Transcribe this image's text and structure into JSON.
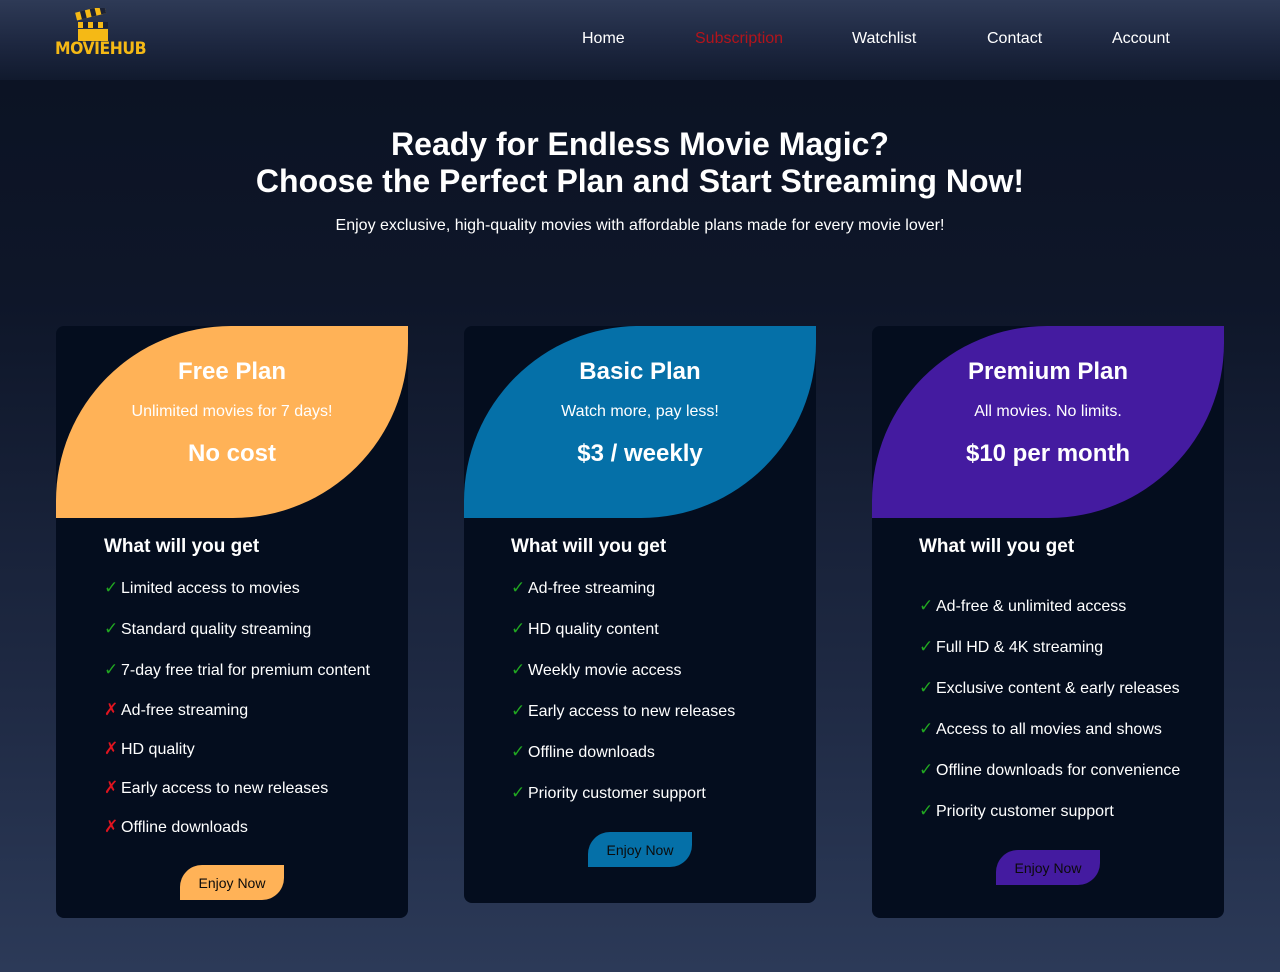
{
  "brand": {
    "name": "MOVIEHUB",
    "logo_icon": "clapperboard-icon",
    "color": "#f5b915"
  },
  "nav": [
    {
      "label": "Home",
      "active": false
    },
    {
      "label": "Subscription",
      "active": true
    },
    {
      "label": "Watchlist",
      "active": false
    },
    {
      "label": "Contact",
      "active": false
    },
    {
      "label": "Account",
      "active": false
    }
  ],
  "hero": {
    "title_line1": "Ready for Endless Movie Magic?",
    "title_line2": "Choose the Perfect Plan and Start Streaming Now!",
    "subtitle": "Enjoy exclusive, high-quality movies with affordable plans made for every movie lover!"
  },
  "plans": [
    {
      "name": "Free Plan",
      "tagline": "Unlimited movies for 7 days!",
      "price": "No cost",
      "accent": "#ffb257",
      "features_title": "What will you get",
      "features": [
        {
          "text": "Limited access to movies",
          "included": true
        },
        {
          "text": "Standard quality streaming",
          "included": true
        },
        {
          "text": "7-day free trial for premium content",
          "included": true
        },
        {
          "text": "Ad-free streaming",
          "included": false
        },
        {
          "text": "HD quality",
          "included": false
        },
        {
          "text": "Early access to new releases",
          "included": false
        },
        {
          "text": "Offline downloads",
          "included": false
        }
      ],
      "cta": "Enjoy Now"
    },
    {
      "name": "Basic Plan",
      "tagline": "Watch more, pay less!",
      "price": "$3 / weekly",
      "accent": "#0570a8",
      "features_title": "What will you get",
      "features": [
        {
          "text": "Ad-free streaming",
          "included": true
        },
        {
          "text": "HD quality content",
          "included": true
        },
        {
          "text": "Weekly movie access",
          "included": true
        },
        {
          "text": "Early access to new releases",
          "included": true
        },
        {
          "text": "Offline downloads",
          "included": true
        },
        {
          "text": "Priority customer support",
          "included": true
        }
      ],
      "cta": "Enjoy Now"
    },
    {
      "name": "Premium Plan",
      "tagline": "All movies. No limits.",
      "price": "$10 per month",
      "accent": "#441ba0",
      "features_title": "What will you get",
      "features": [
        {
          "text": "Ad-free & unlimited access",
          "included": true
        },
        {
          "text": "Full HD & 4K streaming",
          "included": true
        },
        {
          "text": "Exclusive content & early releases",
          "included": true
        },
        {
          "text": "Access to all movies and shows",
          "included": true
        },
        {
          "text": "Offline downloads for convenience",
          "included": true
        },
        {
          "text": "Priority customer support",
          "included": true
        }
      ],
      "cta": "Enjoy Now"
    }
  ],
  "marks": {
    "yes": "✓",
    "no": "✗"
  }
}
